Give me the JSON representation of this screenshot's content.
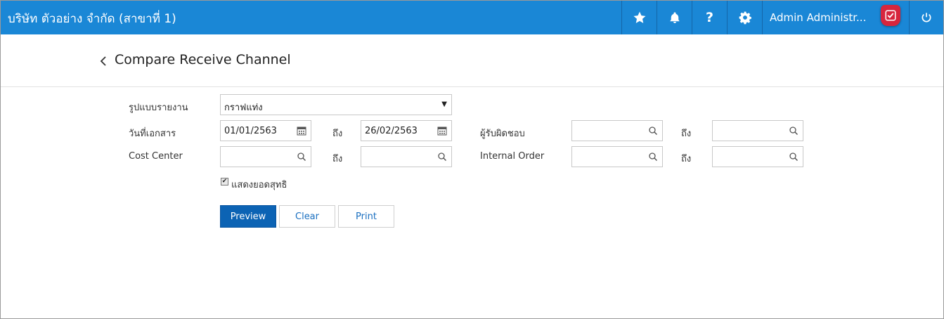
{
  "header": {
    "company": "บริษัท ตัวอย่าง จำกัด (สาขาที่ 1)",
    "user": "Admin Administr...",
    "icons": [
      "star-icon",
      "bell-icon",
      "help-icon",
      "gear-icon",
      "shield-icon",
      "power-icon"
    ]
  },
  "page": {
    "title": "Compare Receive Channel"
  },
  "form": {
    "report_type_label": "รูปแบบรายงาน",
    "report_type_value": "กราฟแท่ง",
    "doc_date_label": "วันที่เอกสาร",
    "doc_date_from": "01/01/2563",
    "to_label": "ถึง",
    "doc_date_to": "26/02/2563",
    "responsible_label": "ผู้รับผิดชอบ",
    "cost_center_label": "Cost Center",
    "internal_order_label": "Internal Order",
    "net_checkbox_label": "แสดงยอดสุทธิ",
    "net_checked": true
  },
  "buttons": {
    "preview": "Preview",
    "clear": "Clear",
    "print": "Print"
  },
  "colors": {
    "topbar": "#1a87d6",
    "primary": "#0c63b4",
    "badge": "#d7263d"
  }
}
